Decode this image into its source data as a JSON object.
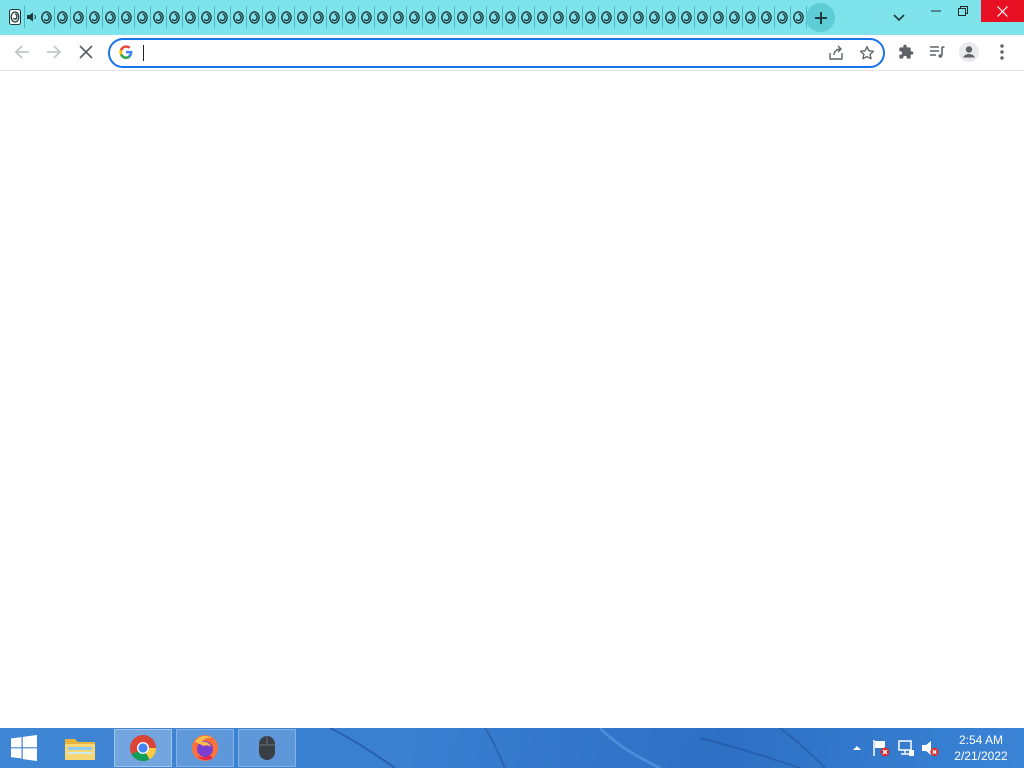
{
  "browser": {
    "tab_count": 50,
    "tab_icon": "spinner-loading-icon",
    "theme_color": "#7ee3ea",
    "omnibox": {
      "value": "",
      "placeholder": ""
    }
  },
  "toolbar": {
    "icons": [
      "back-arrow-icon",
      "forward-arrow-icon",
      "stop-loading-icon",
      "google-g-icon",
      "share-icon",
      "star-icon",
      "puzzle-icon",
      "media-queue-icon",
      "person-icon",
      "kebab-menu-icon"
    ]
  },
  "taskbar": {
    "apps": [
      "file-explorer-icon",
      "chrome-icon",
      "firefox-icon",
      "mouse-icon"
    ],
    "tray_icons": [
      "chevron-up-icon",
      "flag-error-icon",
      "network-icon",
      "volume-muted-icon"
    ],
    "clock": {
      "time": "2:54 AM",
      "date": "2/21/2022"
    }
  }
}
